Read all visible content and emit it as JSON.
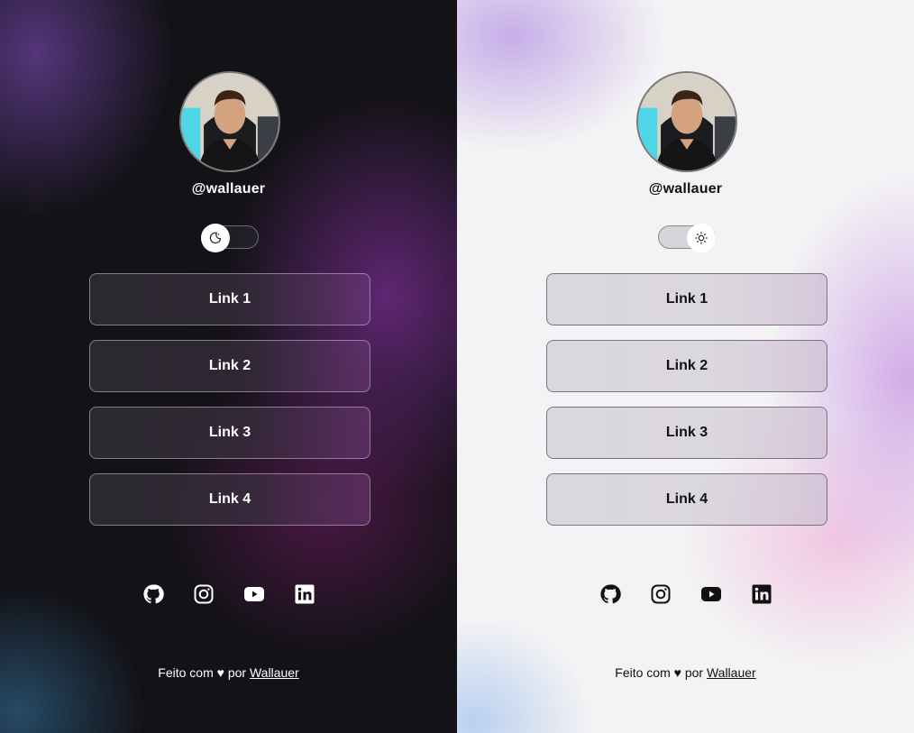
{
  "panels": [
    {
      "theme": "dark",
      "username": "@wallauer",
      "toggle_icon": "moon-icon",
      "links": [
        "Link 1",
        "Link 2",
        "Link 3",
        "Link 4"
      ],
      "socials": [
        "github-icon",
        "instagram-icon",
        "youtube-icon",
        "linkedin-icon"
      ],
      "footer": {
        "prefix": "Feito com ♥ por ",
        "author": "Wallauer"
      }
    },
    {
      "theme": "light",
      "username": "@wallauer",
      "toggle_icon": "sun-icon",
      "links": [
        "Link 1",
        "Link 2",
        "Link 3",
        "Link 4"
      ],
      "socials": [
        "github-icon",
        "instagram-icon",
        "youtube-icon",
        "linkedin-icon"
      ],
      "footer": {
        "prefix": "Feito com ♥ por ",
        "author": "Wallauer"
      }
    }
  ],
  "colors": {
    "dark_bg": "#131217",
    "dark_accent": "#692883",
    "light_bg": "#f3f2f4",
    "light_accent": "#cda0e6"
  }
}
